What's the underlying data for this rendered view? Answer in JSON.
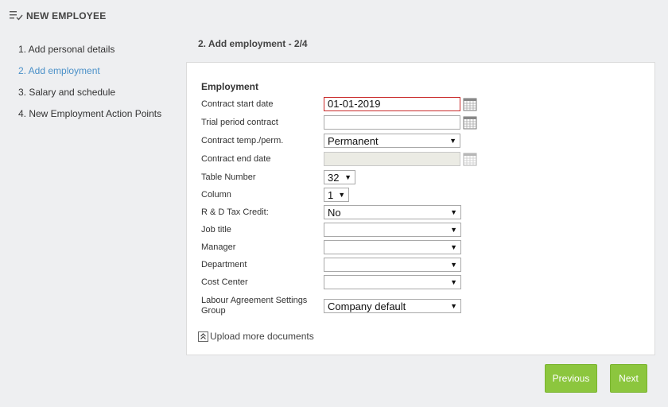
{
  "header": {
    "title": "NEW EMPLOYEE"
  },
  "steps": [
    "1. Add personal details",
    "2. Add employment",
    "3. Salary and schedule",
    "4. New Employment Action Points"
  ],
  "active_step": 1,
  "section_title": "2. Add employment - 2/4",
  "form": {
    "group_title": "Employment",
    "contract_start_date": {
      "label": "Contract start date",
      "value": "01-01-2019"
    },
    "trial_period_contract": {
      "label": "Trial period contract",
      "value": ""
    },
    "contract_type": {
      "label": "Contract temp./perm.",
      "value": "Permanent"
    },
    "contract_end_date": {
      "label": "Contract end date",
      "value": ""
    },
    "table_number": {
      "label": "Table Number",
      "value": "32"
    },
    "column": {
      "label": "Column",
      "value": "1"
    },
    "rd_tax_credit": {
      "label": "R & D Tax Credit:",
      "value": "No"
    },
    "job_title": {
      "label": "Job title",
      "value": ""
    },
    "manager": {
      "label": "Manager",
      "value": ""
    },
    "department": {
      "label": "Department",
      "value": ""
    },
    "cost_center": {
      "label": "Cost Center",
      "value": ""
    },
    "labour_agreement": {
      "label": "Labour Agreement Settings Group",
      "value": "Company default"
    }
  },
  "upload_label": "Upload more documents",
  "buttons": {
    "previous": "Previous",
    "next": "Next"
  },
  "colors": {
    "accent": "#8cc63e",
    "active_step": "#4a90c8",
    "error_border": "#c92a2a"
  }
}
